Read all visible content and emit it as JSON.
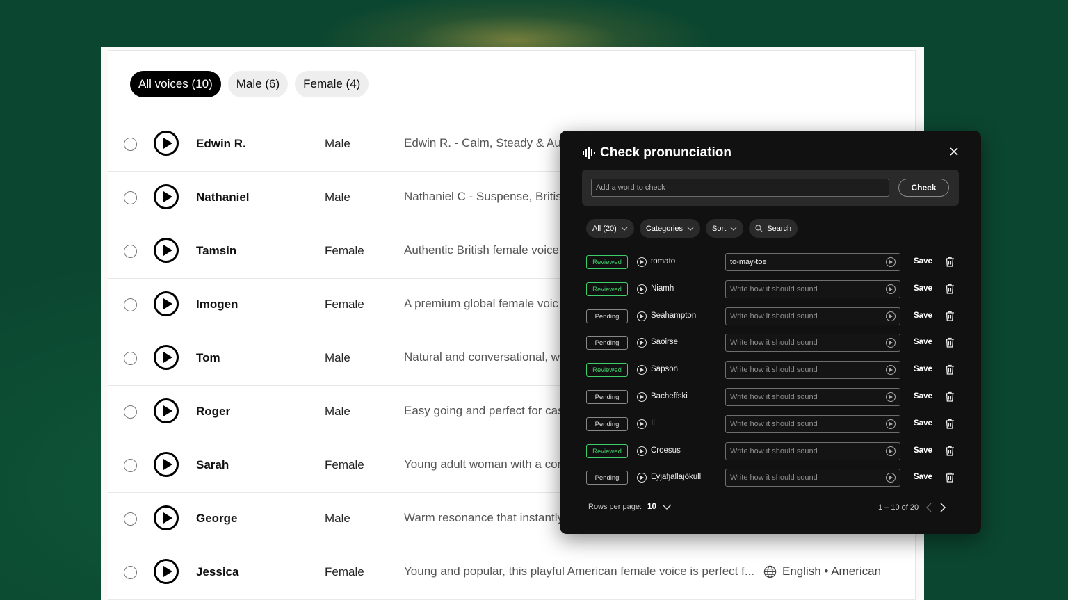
{
  "filters": {
    "tabs": [
      {
        "label": "All voices (10)",
        "active": true
      },
      {
        "label": "Male (6)",
        "active": false
      },
      {
        "label": "Female (4)",
        "active": false
      }
    ]
  },
  "voices": [
    {
      "name": "Edwin R.",
      "gender": "Male",
      "description": "Edwin R. - Calm, Steady & Auth",
      "language": ""
    },
    {
      "name": "Nathaniel",
      "gender": "Male",
      "description": "Nathaniel C - Suspense, British",
      "language": ""
    },
    {
      "name": "Tamsin",
      "gender": "Female",
      "description": "Authentic British female voice",
      "language": ""
    },
    {
      "name": "Imogen",
      "gender": "Female",
      "description": "A premium global female voic",
      "language": ""
    },
    {
      "name": "Tom",
      "gender": "Male",
      "description": "Natural and conversational, wi",
      "language": ""
    },
    {
      "name": "Roger",
      "gender": "Male",
      "description": "Easy going and perfect for cas",
      "language": ""
    },
    {
      "name": "Sarah",
      "gender": "Female",
      "description": "Young adult woman with a cor",
      "language": ""
    },
    {
      "name": "George",
      "gender": "Male",
      "description": "Warm resonance that instantly",
      "language": ""
    },
    {
      "name": "Jessica",
      "gender": "Female",
      "description": "Young and popular, this playful American female voice is perfect f...",
      "language": "English • American"
    }
  ],
  "panel": {
    "title": "Check pronunciation",
    "add_placeholder": "Add a word to check",
    "check_label": "Check",
    "filters": {
      "all_label": "All (20)",
      "categories_label": "Categories",
      "sort_label": "Sort",
      "search_label": "Search"
    },
    "entries": [
      {
        "status": "Reviewed",
        "word": "tomato",
        "pronunciation": "to-may-toe",
        "placeholder": "Write how it should sound",
        "save": "Save"
      },
      {
        "status": "Reviewed",
        "word": "Niamh",
        "pronunciation": "",
        "placeholder": "Write how it should sound",
        "save": "Save"
      },
      {
        "status": "Pending",
        "word": "Seahampton",
        "pronunciation": "",
        "placeholder": "Write how it should sound",
        "save": "Save"
      },
      {
        "status": "Pending",
        "word": "Saoirse",
        "pronunciation": "",
        "placeholder": "Write how it should sound",
        "save": "Save"
      },
      {
        "status": "Reviewed",
        "word": "Sapson",
        "pronunciation": "",
        "placeholder": "Write how it should sound",
        "save": "Save"
      },
      {
        "status": "Pending",
        "word": "Bacheffski",
        "pronunciation": "",
        "placeholder": "Write how it should sound",
        "save": "Save"
      },
      {
        "status": "Pending",
        "word": "Il",
        "pronunciation": "",
        "placeholder": "Write how it should sound",
        "save": "Save"
      },
      {
        "status": "Reviewed",
        "word": "Croesus",
        "pronunciation": "",
        "placeholder": "Write how it should sound",
        "save": "Save"
      },
      {
        "status": "Pending",
        "word": "Eyjafjallajökull",
        "pronunciation": "",
        "placeholder": "Write how it should sound",
        "save": "Save"
      }
    ],
    "pager": {
      "rows_label": "Rows per page:",
      "rows_value": "10",
      "range": "1 – 10 of 20"
    }
  },
  "colors": {
    "background": "#0b4630",
    "reviewed": "#3ecf6b",
    "panel": "#111111"
  }
}
